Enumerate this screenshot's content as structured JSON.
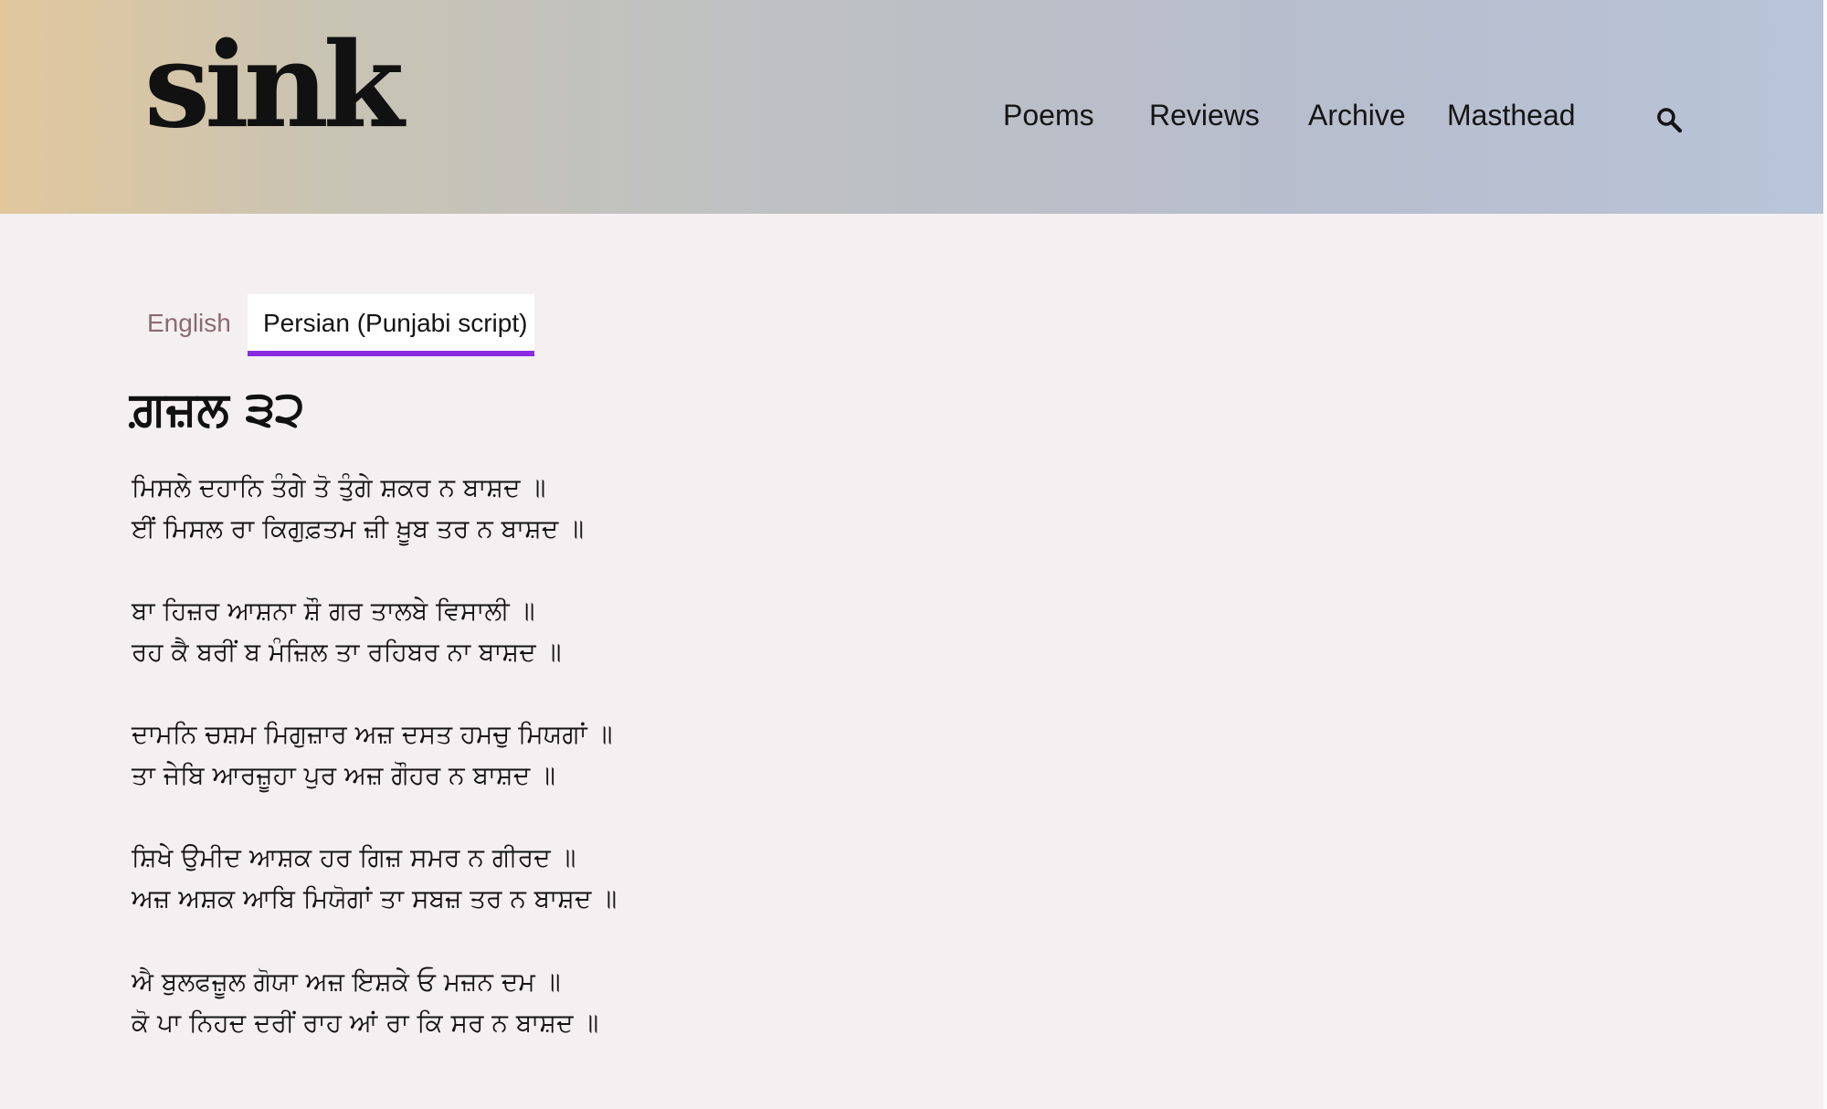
{
  "brand": {
    "logo_text": "sink"
  },
  "nav": {
    "items": [
      {
        "label": "Poems"
      },
      {
        "label": "Reviews"
      },
      {
        "label": "Archive"
      },
      {
        "label": "Masthead"
      }
    ],
    "search_icon": "search-icon"
  },
  "tabs": {
    "items": [
      {
        "label": "English",
        "active": false
      },
      {
        "label": "Persian (Punjabi script)",
        "active": true
      }
    ],
    "active_color": "#8a2be2"
  },
  "poem": {
    "title": "ਗ਼ਜ਼ਲ ੩੨",
    "stanzas": [
      [
        "ਮਿਸਲੇ ਦਹਾਨਿ ਤੰਗੇ ਤੋ ਤੁੰਗੇ ਸ਼ਕਰ ਨ ਬਾਸ਼ਦ ॥",
        "ਈਂ ਮਿਸਲ ਰਾ ਕਿਗੁਫ਼ਤਮ ਜ਼ੀ ਖ਼ੂਬ ਤਰ ਨ ਬਾਸ਼ਦ ॥"
      ],
      [
        "ਬਾ ਹਿਜ਼ਰ ਆਸ਼ਨਾ ਸ਼ੌ ਗਰ ਤਾਲਬੇ ਵਿਸਾਲੀ ॥",
        "ਰਹ ਕੈ ਬਰੀਂ ਬ ਮੰਜ਼ਿਲ ਤਾ ਰਹਿਬਰ ਨਾ ਬਾਸ਼ਦ ॥"
      ],
      [
        "ਦਾਮਨਿ ਚਸ਼ਮ ਮਿਗੁਜ਼ਾਰ ਅਜ਼ ਦਸਤ ਹਮਚੁ ਮਿਯਗਾਂ ॥",
        "ਤਾ ਜੇਬਿ ਆਰਜ਼ੂਹਾ ਪੁਰ ਅਜ਼ ਗੌਹਰ ਨ ਬਾਸ਼ਦ ॥"
      ],
      [
        "ਸ਼ਿਖੇ ਉਮੀਦ ਆਸ਼ਕ ਹਰ ਗਿਜ਼ ਸਮਰ ਨ ਗੀਰਦ ॥",
        "ਅਜ਼ ਅਸ਼ਕ ਆਬਿ ਮਿਯੋਗਾਂ ਤਾ ਸਬਜ਼ ਤਰ ਨ ਬਾਸ਼ਦ ॥"
      ],
      [
        "ਐ ਬੁਲਫਜ਼ੂਲ ਗੋਯਾ ਅਜ਼ ਇਸ਼ਕੇ ਓ ਮਜ਼ਨ ਦਮ ॥",
        "ਕੋ ਪਾ ਨਿਹਦ ਦਰੀਂ ਰਾਹ ਆਂ ਰਾ ਕਿ ਸਰ ਨ ਬਾਸ਼ਦ ॥"
      ]
    ]
  }
}
